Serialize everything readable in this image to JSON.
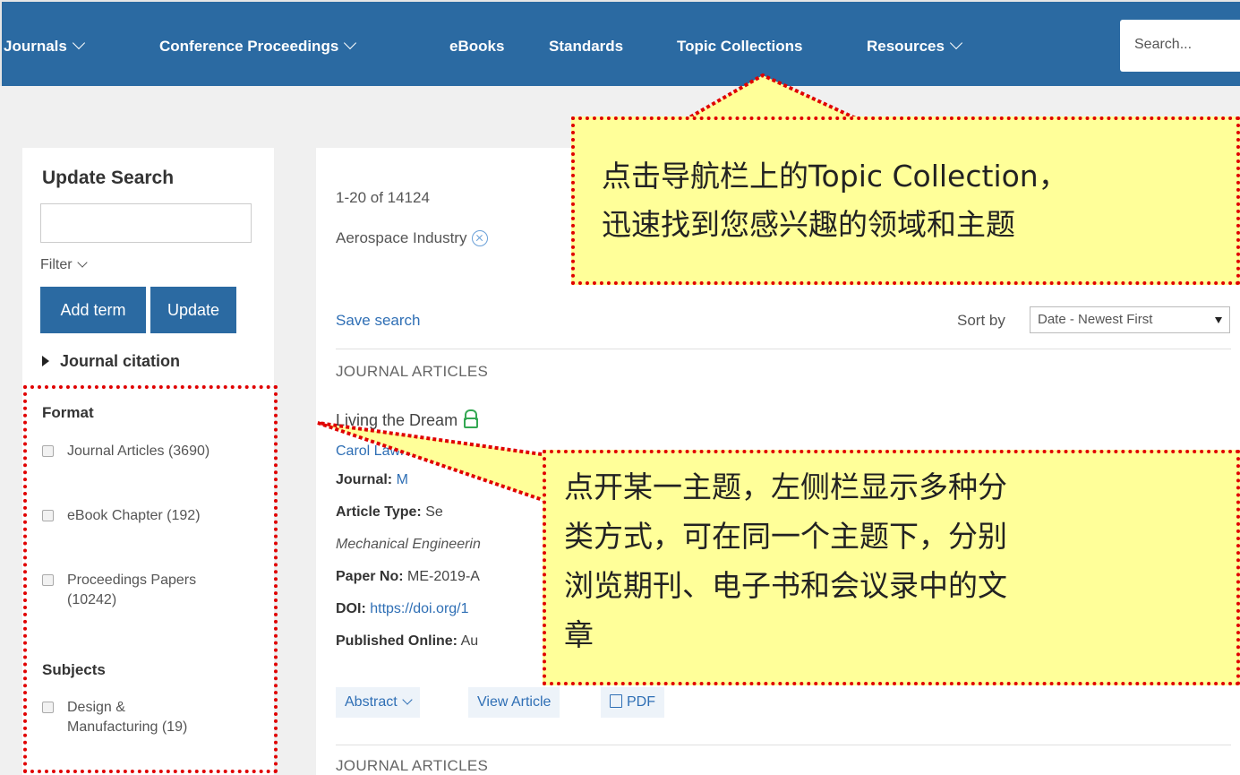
{
  "nav": {
    "items": [
      {
        "label": "Journals",
        "has_menu": true
      },
      {
        "label": "Conference Proceedings",
        "has_menu": true
      },
      {
        "label": "eBooks",
        "has_menu": false
      },
      {
        "label": "Standards",
        "has_menu": false
      },
      {
        "label": "Topic Collections",
        "has_menu": false
      },
      {
        "label": "Resources",
        "has_menu": true
      }
    ],
    "search_placeholder": "Search..."
  },
  "sidebar": {
    "title": "Update Search",
    "filter_label": "Filter",
    "add_term_label": "Add term",
    "update_label": "Update",
    "journal_citation_label": "Journal citation",
    "format_heading": "Format",
    "format_items": [
      {
        "label": "Journal Articles (3690)"
      },
      {
        "label": "eBook Chapter (192)"
      },
      {
        "label": "Proceedings Papers (10242)"
      }
    ],
    "subjects_heading": "Subjects",
    "subject_items": [
      {
        "label": "Design & Manufacturing (19)"
      }
    ]
  },
  "results": {
    "count_text": "1-20 of 14124",
    "active_facet": "Aerospace Industry",
    "save_search_label": "Save search",
    "sort_label": "Sort by",
    "sort_value": "Date - Newest First",
    "items": [
      {
        "type": "JOURNAL ARTICLES",
        "title": "Living the Dream",
        "author_visible": "Carol Lawrence",
        "journal_label": "Journal:",
        "journal_value": "M",
        "article_type_label": "Article Type:",
        "article_type_value": "Se",
        "citation_visible": "Mechanical Engineerin",
        "paper_no_label": "Paper No:",
        "paper_no_value": "ME-2019-A",
        "doi_label": "DOI:",
        "doi_value": "https://doi.org/1",
        "published_label": "Published Online:",
        "published_value": "Au",
        "actions": {
          "abstract": "Abstract",
          "view": "View Article",
          "pdf": "PDF"
        }
      },
      {
        "type": "JOURNAL ARTICLES"
      }
    ]
  },
  "callouts": {
    "top": [
      "点击导航栏上的Topic Collection，",
      "迅速找到您感兴趣的领域和主题"
    ],
    "bottom": [
      "点开某一主题，左侧栏显示多种分",
      "类方式，可在同一个主题下，分别",
      "浏览期刊、电子书和会议录中的文",
      "章"
    ]
  },
  "colors": {
    "nav_bg": "#2b6aa2",
    "callout_bg": "#ffff99",
    "callout_border": "#e00000",
    "link": "#2f6fb5",
    "open_access": "#34a853"
  }
}
